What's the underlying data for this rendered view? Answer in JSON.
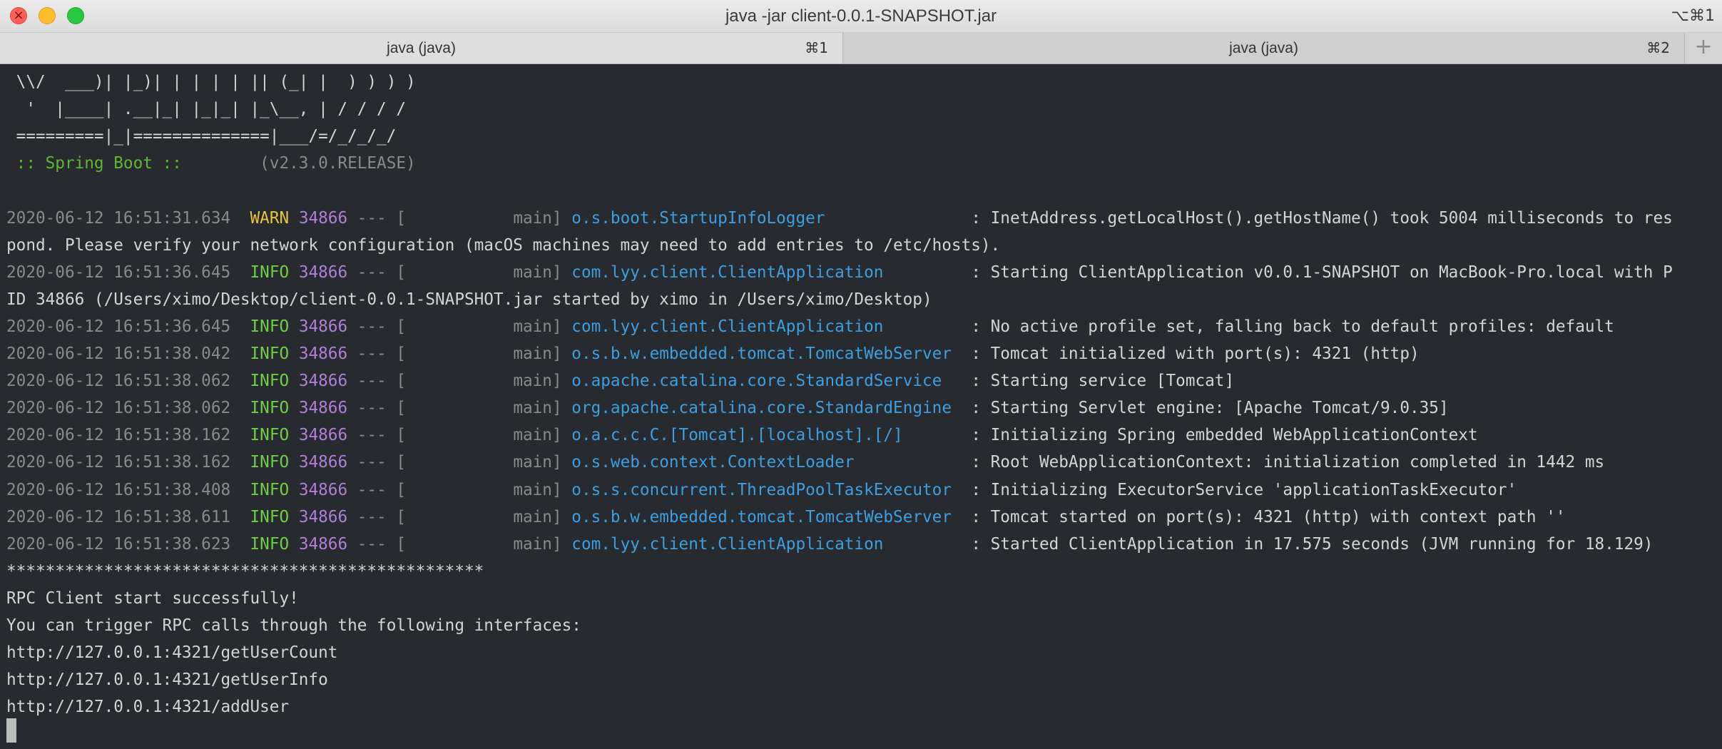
{
  "window": {
    "title": "java -jar client-0.0.1-SNAPSHOT.jar",
    "shortcut": "⌥⌘1",
    "colors": {
      "close": "#fe5f57",
      "minimize": "#febc2e",
      "maximize": "#28c840"
    }
  },
  "tabs": [
    {
      "label": "java (java)",
      "shortcut": "⌘1"
    },
    {
      "label": "java (java)",
      "shortcut": "⌘2"
    }
  ],
  "new_tab_icon": "plus-icon",
  "terminal": {
    "colors": {
      "background": "#272a2e",
      "text": "#d4d4d4",
      "warn": "#e8c43c",
      "info": "#6fcf45",
      "pid": "#b07fd8",
      "logger": "#3d9fe0",
      "spring": "#5fb832"
    },
    "banner": [
      " \\\\/  ___)| |_)| | | | | || (_| |  ) ) ) )",
      "  '  |____| .__|_| |_|_| |_\\__, | / / / /",
      " =========|_|==============|___/=/_/_/_/"
    ],
    "spring_label": " :: Spring Boot ::",
    "spring_version": "        (v2.3.0.RELEASE)",
    "logs": [
      {
        "ts": "2020-06-12 16:51:31.634",
        "level": "WARN",
        "pid": "34866",
        "sep": " --- [",
        "thread": "           main]",
        "logger": "o.s.boot.StartupInfoLogger              ",
        "msg": " : InetAddress.getLocalHost().getHostName() took 5004 milliseconds to res",
        "cont": "pond. Please verify your network configuration (macOS machines may need to add entries to /etc/hosts)."
      },
      {
        "ts": "2020-06-12 16:51:36.645",
        "level": "INFO",
        "pid": "34866",
        "sep": " --- [",
        "thread": "           main]",
        "logger": "com.lyy.client.ClientApplication        ",
        "msg": " : Starting ClientApplication v0.0.1-SNAPSHOT on MacBook-Pro.local with P",
        "cont": "ID 34866 (/Users/ximo/Desktop/client-0.0.1-SNAPSHOT.jar started by ximo in /Users/ximo/Desktop)"
      },
      {
        "ts": "2020-06-12 16:51:36.645",
        "level": "INFO",
        "pid": "34866",
        "sep": " --- [",
        "thread": "           main]",
        "logger": "com.lyy.client.ClientApplication        ",
        "msg": " : No active profile set, falling back to default profiles: default"
      },
      {
        "ts": "2020-06-12 16:51:38.042",
        "level": "INFO",
        "pid": "34866",
        "sep": " --- [",
        "thread": "           main]",
        "logger": "o.s.b.w.embedded.tomcat.TomcatWebServer ",
        "msg": " : Tomcat initialized with port(s): 4321 (http)"
      },
      {
        "ts": "2020-06-12 16:51:38.062",
        "level": "INFO",
        "pid": "34866",
        "sep": " --- [",
        "thread": "           main]",
        "logger": "o.apache.catalina.core.StandardService  ",
        "msg": " : Starting service [Tomcat]"
      },
      {
        "ts": "2020-06-12 16:51:38.062",
        "level": "INFO",
        "pid": "34866",
        "sep": " --- [",
        "thread": "           main]",
        "logger": "org.apache.catalina.core.StandardEngine ",
        "msg": " : Starting Servlet engine: [Apache Tomcat/9.0.35]"
      },
      {
        "ts": "2020-06-12 16:51:38.162",
        "level": "INFO",
        "pid": "34866",
        "sep": " --- [",
        "thread": "           main]",
        "logger": "o.a.c.c.C.[Tomcat].[localhost].[/]      ",
        "msg": " : Initializing Spring embedded WebApplicationContext"
      },
      {
        "ts": "2020-06-12 16:51:38.162",
        "level": "INFO",
        "pid": "34866",
        "sep": " --- [",
        "thread": "           main]",
        "logger": "o.s.web.context.ContextLoader           ",
        "msg": " : Root WebApplicationContext: initialization completed in 1442 ms"
      },
      {
        "ts": "2020-06-12 16:51:38.408",
        "level": "INFO",
        "pid": "34866",
        "sep": " --- [",
        "thread": "           main]",
        "logger": "o.s.s.concurrent.ThreadPoolTaskExecutor ",
        "msg": " : Initializing ExecutorService 'applicationTaskExecutor'"
      },
      {
        "ts": "2020-06-12 16:51:38.611",
        "level": "INFO",
        "pid": "34866",
        "sep": " --- [",
        "thread": "           main]",
        "logger": "o.s.b.w.embedded.tomcat.TomcatWebServer ",
        "msg": " : Tomcat started on port(s): 4321 (http) with context path ''"
      },
      {
        "ts": "2020-06-12 16:51:38.623",
        "level": "INFO",
        "pid": "34866",
        "sep": " --- [",
        "thread": "           main]",
        "logger": "com.lyy.client.ClientApplication        ",
        "msg": " : Started ClientApplication in 17.575 seconds (JVM running for 18.129)"
      }
    ],
    "separator": "*************************************************",
    "messages": [
      "RPC Client start successfully!",
      "You can trigger RPC calls through the following interfaces:",
      "http://127.0.0.1:4321/getUserCount",
      "http://127.0.0.1:4321/getUserInfo",
      "http://127.0.0.1:4321/addUser"
    ]
  }
}
